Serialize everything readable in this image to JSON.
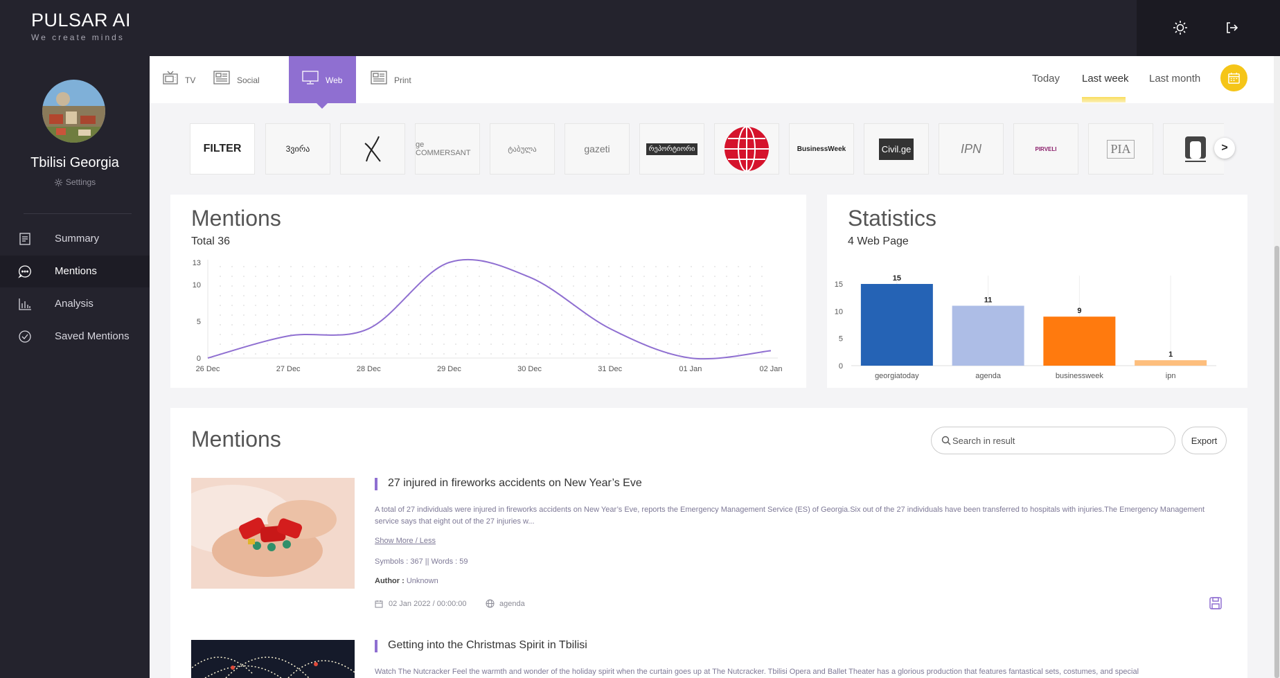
{
  "brand": {
    "title": "PULSAR AI",
    "tagline": "We create minds"
  },
  "header": {
    "icons": [
      "sun-icon",
      "logout-icon"
    ]
  },
  "profile": {
    "name": "Tbilisi Georgia",
    "settings_label": "Settings"
  },
  "sidebar": {
    "items": [
      {
        "label": "Summary",
        "icon": "document-icon"
      },
      {
        "label": "Mentions",
        "icon": "chat-icon",
        "active": true
      },
      {
        "label": "Analysis",
        "icon": "bar-chart-icon"
      },
      {
        "label": "Saved Mentions",
        "icon": "check-circle-icon"
      }
    ]
  },
  "source_tabs": [
    {
      "label": "TV",
      "icon": "tv-icon"
    },
    {
      "label": "Social",
      "icon": "newspaper-icon"
    },
    {
      "label": "Web",
      "icon": "monitor-icon",
      "active": true
    },
    {
      "label": "Print",
      "icon": "print-icon"
    }
  ],
  "date_ranges": [
    {
      "label": "Today"
    },
    {
      "label": "Last week",
      "active": true
    },
    {
      "label": "Last month"
    }
  ],
  "accent": "#8f6fd1",
  "highlight": "#f5c518",
  "logos": {
    "filter_label": "FILTER",
    "items": [
      "3ვირა",
      "X logo",
      "ge COMMERSANT",
      "ტაბულა",
      "gazeti",
      "რეპორტიორი",
      "red globe",
      "BusinessWeek",
      "Civil.ge",
      "IPN",
      "PIRVELI",
      "PIA",
      "Interpressnews"
    ],
    "next_label": ">"
  },
  "mentions_chart": {
    "title": "Mentions",
    "total_label": "Total 36"
  },
  "statistics_chart": {
    "title": "Statistics",
    "subtitle": "4 Web Page"
  },
  "chart_data": [
    {
      "type": "line",
      "title": "Mentions",
      "subtitle": "Total 36",
      "x": [
        "26 Dec",
        "27 Dec",
        "28 Dec",
        "29 Dec",
        "30 Dec",
        "31 Dec",
        "01 Jan",
        "02 Jan"
      ],
      "series": [
        {
          "values": [
            0,
            3,
            4,
            13,
            11,
            4,
            0,
            1
          ]
        }
      ],
      "yticks": [
        0,
        5,
        10,
        13
      ],
      "ylim": [
        0,
        13
      ],
      "grid": "dotted",
      "line_color": "#8f6fd1"
    },
    {
      "type": "bar",
      "title": "Statistics",
      "subtitle": "4 Web Page",
      "categories": [
        "georgiatoday",
        "agenda",
        "businessweek",
        "ipn"
      ],
      "values": [
        15,
        11,
        9,
        1
      ],
      "colors": [
        "#2563b5",
        "#adbde6",
        "#ff7a0e",
        "#fdbe7d"
      ],
      "yticks": [
        0,
        5,
        10,
        15
      ],
      "ylim": [
        0,
        15
      ]
    }
  ],
  "mentions_list": {
    "title": "Mentions",
    "search_placeholder": "Search in result",
    "export_label": "Export",
    "articles": [
      {
        "title": "27 injured in fireworks accidents on New Year’s Eve",
        "body": "A total of 27 individuals were injured in fireworks accidents on New Year’s Eve, reports the Emergency Management Service (ES) of Georgia.Six out of the 27 individuals have been transferred to hospitals with injuries.The Emergency Management service says that eight out of the 27 injuries w...",
        "show_more": "Show More / Less",
        "stats": "Symbols : 367 || Words : 59",
        "author_label": "Author :",
        "author": "Unknown",
        "date": "02 Jan 2022 / 00:00:00",
        "source": "agenda"
      },
      {
        "title": "Getting into the Christmas Spirit in Tbilisi",
        "body": "Watch The Nutcracker Feel the warmth and wonder of the holiday spirit when the curtain goes up at The Nutcracker. Tbilisi Opera and Ballet Theater has a glorious production that features fantastical sets, costumes, and special"
      }
    ]
  }
}
